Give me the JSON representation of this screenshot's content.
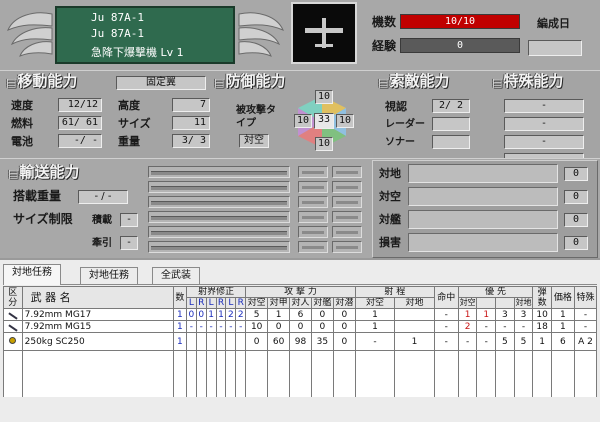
{
  "colors": {
    "header_green": "#2f6a4e",
    "bar_red": "#c00000",
    "tab_bg": "#ececec"
  },
  "plane": {
    "name1": "Ju 87A-1",
    "name2": "Ju 87A-1",
    "role": "急降下爆撃機 Lv 1",
    "icon": "plane-silhouette-icon"
  },
  "stats_top": {
    "count_label": "機数",
    "count_value": "10/10",
    "count_fraction": 1.0,
    "exp_label": "経験",
    "exp_value": "0",
    "unit_date_label": "編成日",
    "unit_date_value": ""
  },
  "mobility": {
    "title": "移動能力",
    "type": "固定翼",
    "speed_label": "速度",
    "speed": "12/12",
    "fuel_label": "燃料",
    "fuel": "61/ 61",
    "battery_label": "電池",
    "battery": "-/ -",
    "altitude_label": "高度",
    "altitude": "7",
    "size_label": "サイズ",
    "size": "11",
    "weight_label": "重量",
    "weight": "3/ 3"
  },
  "defense": {
    "title": "防御能力",
    "attacked_type_label": "被攻撃タイプ",
    "attacked_type": "対空",
    "hex": {
      "top": "10",
      "left": "10",
      "center": "33",
      "right": "10",
      "bottom": "10"
    }
  },
  "search": {
    "title": "索敵能力",
    "visual_label": "視認",
    "visual": "2/ 2",
    "radar_label": "レーダー",
    "radar": "",
    "sonar_label": "ソナー",
    "sonar": ""
  },
  "special": {
    "title": "特殊能力",
    "values": [
      "-",
      "-",
      "-",
      "-"
    ]
  },
  "transport": {
    "title": "輸送能力",
    "load_weight_label": "搭載重量",
    "load_weight": "- / -",
    "size_limit_label": "サイズ制限",
    "carry_label": "積載",
    "carry": "-",
    "tow_label": "牽引",
    "tow": "-"
  },
  "target_panel": {
    "rows": [
      {
        "label": "対地",
        "value": "0"
      },
      {
        "label": "対空",
        "value": "0"
      },
      {
        "label": "対艦",
        "value": "0"
      },
      {
        "label": "損害",
        "value": "0"
      }
    ]
  },
  "tabs": [
    "対地任務",
    "対地任務",
    "全武装"
  ],
  "weapons_header": {
    "kubun": "区分",
    "buki": "武 器 名",
    "kazu": "数",
    "shakai": "射界修正",
    "L": "L",
    "R": "R",
    "kougeki": "攻 撃 力",
    "atk_cols": [
      "対空",
      "対甲",
      "対人",
      "対艦",
      "対潜"
    ],
    "shatei": "射 程",
    "range_cols": [
      "対空",
      "対地"
    ],
    "meichu": "命中",
    "yusen": "優 先",
    "prio_cols": [
      "対空",
      "",
      "",
      "対地"
    ],
    "danyaku": "弾数",
    "kakaku": "価格",
    "tokushu": "特殊"
  },
  "weapons": [
    {
      "icon": "gun-icon",
      "name": "7.92mm MG17",
      "count": "1",
      "fire": [
        "0",
        "0",
        "1",
        "1",
        "2",
        "2"
      ],
      "atk": [
        "5",
        "1",
        "6",
        "0",
        "0"
      ],
      "range": [
        "1",
        ""
      ],
      "hit": "-",
      "prio": [
        "1",
        "1",
        "3",
        "3"
      ],
      "ammo": "10",
      "price": "1",
      "special": "-"
    },
    {
      "icon": "gun-icon",
      "name": "7.92mm MG15",
      "count": "1",
      "fire": [
        "-",
        "-",
        "-",
        "-",
        "-",
        "-"
      ],
      "atk": [
        "10",
        "0",
        "0",
        "0",
        "0"
      ],
      "range": [
        "1",
        ""
      ],
      "hit": "-",
      "prio": [
        "2",
        "-",
        "-",
        "-"
      ],
      "ammo": "18",
      "price": "1",
      "special": "-"
    },
    {
      "icon": "bomb-icon",
      "name": "250kg SC250",
      "count": "1",
      "fire": [
        "",
        "",
        "",
        "",
        "",
        ""
      ],
      "atk": [
        "0",
        "60",
        "98",
        "35",
        "0"
      ],
      "range": [
        "-",
        "1"
      ],
      "hit": "-",
      "prio": [
        "-",
        "-",
        "5",
        "5"
      ],
      "ammo": "1",
      "price": "6",
      "special": "A 2"
    }
  ]
}
